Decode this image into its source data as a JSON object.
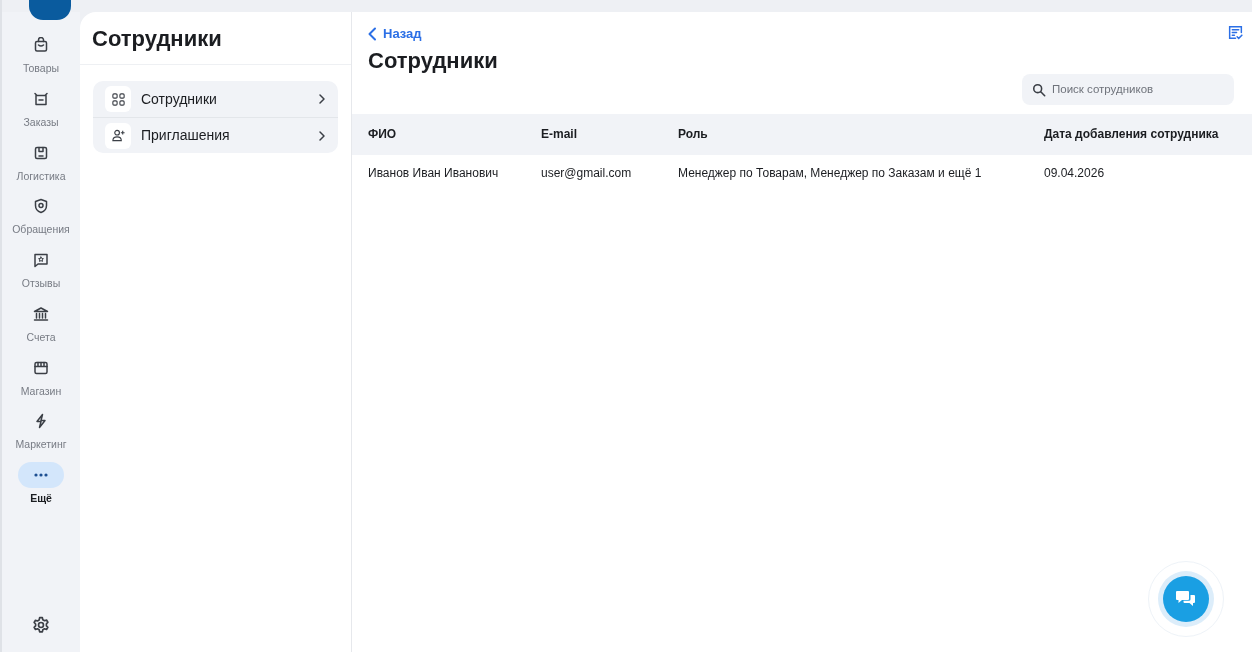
{
  "rail": {
    "items": [
      {
        "label": "Товары",
        "selected": false
      },
      {
        "label": "Заказы",
        "selected": false
      },
      {
        "label": "Логистика",
        "selected": false
      },
      {
        "label": "Обращения",
        "selected": false
      },
      {
        "label": "Отзывы",
        "selected": false
      },
      {
        "label": "Счета",
        "selected": false
      },
      {
        "label": "Магазин",
        "selected": false
      },
      {
        "label": "Маркетинг",
        "selected": false
      },
      {
        "label": "Ещё",
        "selected": true
      }
    ]
  },
  "sidebar": {
    "title": "Сотрудники",
    "items": [
      {
        "label": "Сотрудники"
      },
      {
        "label": "Приглашения"
      }
    ]
  },
  "main": {
    "back": "Назад",
    "title": "Сотрудники",
    "search": {
      "placeholder": "Поиск сотрудников"
    },
    "table": {
      "columns": [
        "ФИО",
        "E-mail",
        "Роль",
        "Дата добавления сотрудника"
      ],
      "rows": [
        [
          "Иванов Иван Иванович",
          "user@gmail.com",
          "Менеджер по Товарам, Менеджер по Заказам и ещё 1",
          "09.04.2026"
        ]
      ]
    }
  }
}
